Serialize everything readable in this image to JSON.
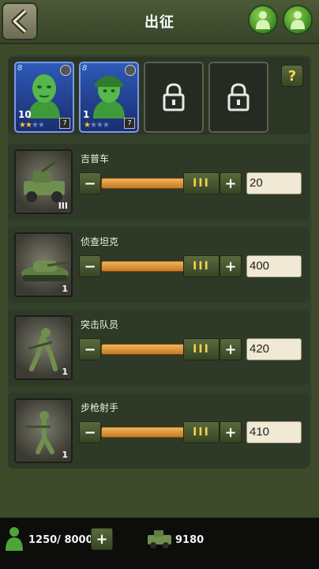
{
  "header": {
    "title": "出征"
  },
  "heroes": [
    {
      "tag": "8",
      "level": "10",
      "rank": "7",
      "stars": 2
    },
    {
      "tag": "8",
      "level": "1",
      "rank": "7",
      "stars": 1
    }
  ],
  "help_label": "?",
  "units": [
    {
      "name": "吉普车",
      "count": "III",
      "quantity": "20"
    },
    {
      "name": "侦查坦克",
      "count": "1",
      "quantity": "400"
    },
    {
      "name": "突击队员",
      "count": "1",
      "quantity": "420"
    },
    {
      "name": "步枪射手",
      "count": "1",
      "quantity": "410"
    }
  ],
  "slider_thumb_label": "III",
  "footer": {
    "troops": "1250/ 8000",
    "vehicles": "9180"
  }
}
